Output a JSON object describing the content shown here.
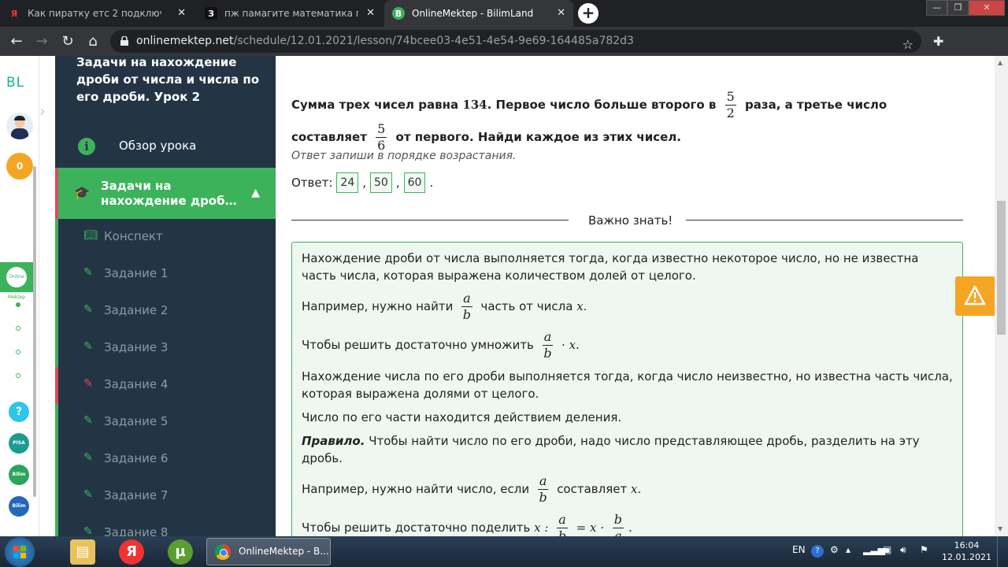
{
  "browser": {
    "tabs": [
      {
        "label": "Как пиратку етс 2 подключить к",
        "favicon": "Я",
        "active": false
      },
      {
        "label": "пж памагите математика пж20 б",
        "favicon": "З",
        "active": false
      },
      {
        "label": "OnlineMektep - BilimLand",
        "favicon": "B",
        "active": true
      }
    ],
    "url_domain": "onlinemektep.net",
    "url_path": "/schedule/12.01.2021/lesson/74bcee03-4e51-4e54-9e69-164485a782d3"
  },
  "left_rail": {
    "logo": "BL",
    "coins": "0",
    "online_label": "Online Mektep",
    "links": [
      "?",
      "PISA",
      "Bilim Land",
      "Bilim Book"
    ]
  },
  "sidebar": {
    "lesson_title": "Задачи на нахождение дроби от числа и числа по его дроби. Урок 2",
    "overview_label": "Обзор урока",
    "active_section": "Задачи на нахождение дроб…",
    "items": [
      {
        "label": "Конспект",
        "icon": "book-icon",
        "status": "normal"
      },
      {
        "label": "Задание 1",
        "icon": "edit-icon",
        "status": "normal"
      },
      {
        "label": "Задание 2",
        "icon": "edit-icon",
        "status": "normal"
      },
      {
        "label": "Задание 3",
        "icon": "edit-icon",
        "status": "normal"
      },
      {
        "label": "Задание 4",
        "icon": "edit-icon",
        "status": "error"
      },
      {
        "label": "Задание 5",
        "icon": "edit-icon",
        "status": "normal"
      },
      {
        "label": "Задание 6",
        "icon": "edit-icon",
        "status": "normal"
      },
      {
        "label": "Задание 7",
        "icon": "edit-icon",
        "status": "normal"
      },
      {
        "label": "Задание 8",
        "icon": "edit-icon",
        "status": "normal"
      }
    ]
  },
  "task": {
    "text_part1": "Сумма трех чисел равна",
    "sum": "134",
    "text_part2": ". Первое число больше второго в",
    "frac1_num": "5",
    "frac1_den": "2",
    "text_part3": "раза, а третье число составляет",
    "frac2_num": "5",
    "frac2_den": "6",
    "text_part4": "от первого. Найди каждое из этих чисел.",
    "hint": "Ответ запиши в порядке возрастания.",
    "answer_label": "Ответ:",
    "answers": [
      "24",
      "50",
      "60"
    ]
  },
  "important": {
    "heading": "Важно знать!",
    "p1": "Нахождение дроби от числа выполняется тогда, когда известно некоторое число, но не известна часть числа, которая выражена количеством долей от целого.",
    "p2_before": "Например, нужно найти",
    "p2_after": "часть от числа",
    "p3": "Чтобы решить достаточно умножить",
    "p4": "Нахождение числа по его дроби выполняется тогда, когда число неизвестно, но известна часть числа, которая выражена долями от целого.",
    "p5": "Число по его части находится действием деления.",
    "rule_label": "Правило.",
    "rule_text": "Чтобы найти число по его дроби, надо число представляющее дробь, разделить на эту дробь.",
    "p6_before": "Например, нужно найти число, если",
    "p6_after": "составляет",
    "p7": "Чтобы решить достаточно поделить",
    "var_a": "a",
    "var_b": "b",
    "var_x": "x"
  },
  "taskbar": {
    "app_label": "OnlineMektep - B...",
    "lang": "EN",
    "time": "16:04",
    "date": "12.01.2021"
  },
  "colors": {
    "accent": "#3cb35a",
    "sidebar_bg": "#233545",
    "error": "#e0475b",
    "warning": "#f5a524"
  }
}
